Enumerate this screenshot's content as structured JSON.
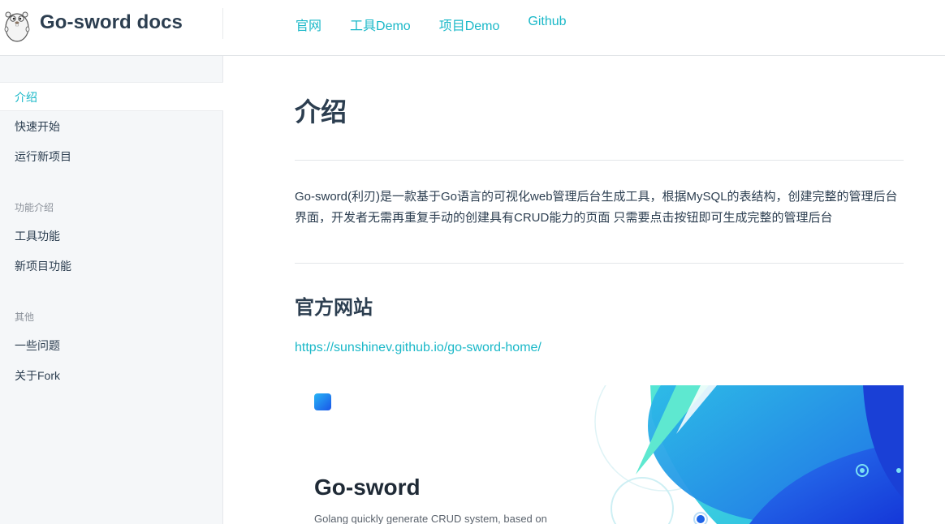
{
  "header": {
    "site_name": "Go-sword docs",
    "logo_icon": "gopher-logo-icon",
    "nav": [
      {
        "label": "官网"
      },
      {
        "label": "工具Demo"
      },
      {
        "label": "项目Demo"
      },
      {
        "label": "Github"
      }
    ]
  },
  "sidebar": {
    "items_top": [
      {
        "label": "介绍",
        "active": true
      },
      {
        "label": "快速开始"
      },
      {
        "label": "运行新项目"
      }
    ],
    "group_features": {
      "title": "功能介绍",
      "items": [
        {
          "label": "工具功能"
        },
        {
          "label": "新项目功能"
        }
      ]
    },
    "group_other": {
      "title": "其他",
      "items": [
        {
          "label": "一些问题"
        },
        {
          "label": "关于Fork"
        }
      ]
    }
  },
  "main": {
    "title": "介绍",
    "intro": "Go-sword(利刃)是一款基于Go语言的可视化web管理后台生成工具，根据MySQL的表结构，创建完整的管理后台界面，开发者无需再重复手动的创建具有CRUD能力的页面 只需要点击按钮即可生成完整的管理后台",
    "section_title": "官方网站",
    "site_url": "https://sunshinev.github.io/go-sword-home/",
    "preview": {
      "title": "Go-sword",
      "subtitle": "Golang quickly generate CRUD system, based on"
    }
  },
  "colors": {
    "accent": "#1ab8c8",
    "text": "#2c3e50",
    "sidebar_bg": "#f5f7f9"
  }
}
